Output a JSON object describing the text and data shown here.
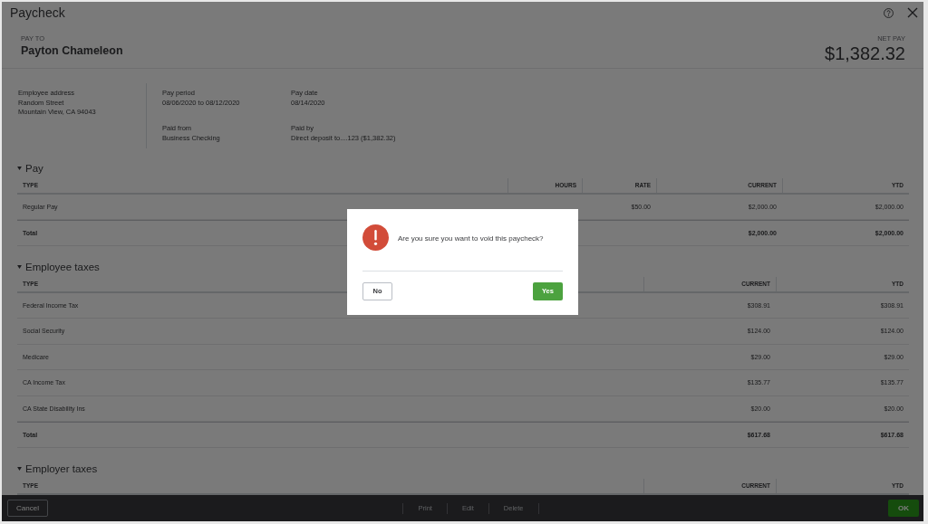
{
  "window": {
    "title": "Paycheck"
  },
  "header": {
    "pay_to_label": "PAY TO",
    "payee": "Payton Chameleon",
    "net_pay_label": "NET PAY",
    "net_pay": "$1,382.32"
  },
  "details": {
    "address": {
      "label": "Employee address",
      "lines": [
        "Random Street",
        "Mountain View, CA 94043"
      ]
    },
    "fields": [
      {
        "label": "Pay period",
        "value": "08/06/2020 to 08/12/2020"
      },
      {
        "label": "Pay date",
        "value": "08/14/2020"
      },
      {
        "label": "Paid from",
        "value": "Business Checking"
      },
      {
        "label": "Paid by",
        "value": "Direct deposit to....123 ($1,382.32)"
      }
    ]
  },
  "sections": [
    {
      "title": "Pay",
      "expanded": true,
      "columns": [
        "TYPE",
        "HOURS",
        "RATE",
        "CURRENT",
        "YTD"
      ],
      "rows": [
        {
          "kind": "item",
          "cells": [
            "Regular Pay",
            null,
            "$50.00",
            "$2,000.00",
            "$2,000.00"
          ]
        },
        {
          "kind": "total",
          "cells": [
            "Total",
            null,
            null,
            "$2,000.00",
            "$2,000.00"
          ]
        }
      ]
    },
    {
      "title": "Employee taxes",
      "expanded": true,
      "columns": [
        "TYPE",
        "CURRENT",
        "YTD"
      ],
      "rows": [
        {
          "kind": "item",
          "cells": [
            "Federal Income Tax",
            "$308.91",
            "$308.91"
          ]
        },
        {
          "kind": "item",
          "cells": [
            "Social Security",
            "$124.00",
            "$124.00"
          ]
        },
        {
          "kind": "item",
          "cells": [
            "Medicare",
            "$29.00",
            "$29.00"
          ]
        },
        {
          "kind": "item",
          "cells": [
            "CA Income Tax",
            "$135.77",
            "$135.77"
          ]
        },
        {
          "kind": "item",
          "cells": [
            "CA State Disability Ins",
            "$20.00",
            "$20.00"
          ]
        },
        {
          "kind": "total",
          "cells": [
            "Total",
            "$617.68",
            "$617.68"
          ]
        }
      ]
    },
    {
      "title": "Employer taxes",
      "expanded": true,
      "columns": [
        "TYPE",
        "CURRENT",
        "YTD"
      ]
    }
  ],
  "footer": {
    "cancel": "Cancel",
    "actions": [
      {
        "label": "Print",
        "disabled": true
      },
      {
        "label": "Edit",
        "disabled": true
      },
      {
        "label": "Delete",
        "disabled": true
      }
    ],
    "ok": "OK"
  },
  "dialog": {
    "message": "Are you sure you want to void this paycheck?",
    "no": "No",
    "yes": "Yes"
  }
}
